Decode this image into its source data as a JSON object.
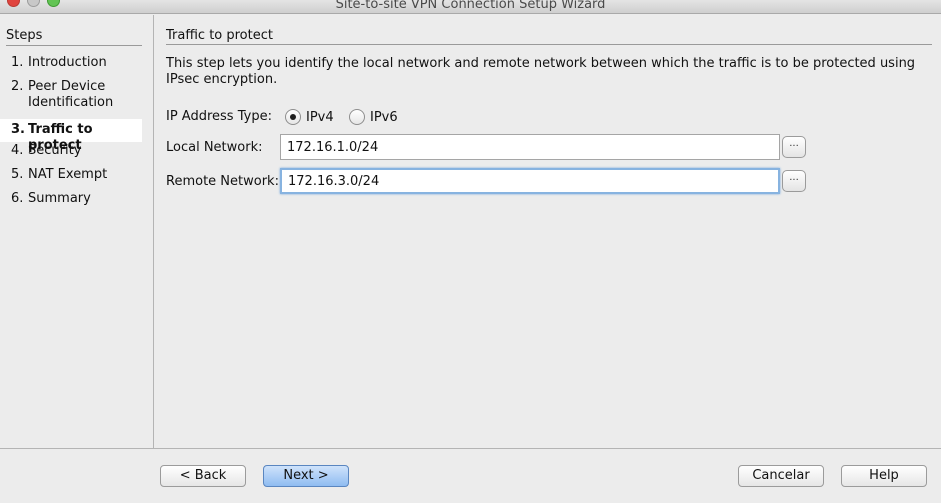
{
  "window": {
    "title": "Site-to-site VPN Connection Setup Wizard"
  },
  "sidebar": {
    "header": "Steps",
    "items": [
      {
        "num": "1.",
        "label": "Introduction"
      },
      {
        "num": "2.",
        "label": "Peer Device Identification"
      },
      {
        "num": "3.",
        "label": "Traffic to protect",
        "active": true
      },
      {
        "num": "4.",
        "label": "Security"
      },
      {
        "num": "5.",
        "label": "NAT Exempt"
      },
      {
        "num": "6.",
        "label": "Summary"
      }
    ]
  },
  "main": {
    "section_title": "Traffic to protect",
    "description": "This step lets you identify the local network and remote network between which the traffic is to be protected using IPsec encryption.",
    "ip_type": {
      "label": "IP Address Type:",
      "options": [
        {
          "label": "IPv4",
          "selected": true
        },
        {
          "label": "IPv6",
          "selected": false
        }
      ]
    },
    "local_network": {
      "label": "Local Network:",
      "value": "172.16.1.0/24",
      "browse_label": "..."
    },
    "remote_network": {
      "label": "Remote Network:",
      "value": "172.16.3.0/24",
      "browse_label": "..."
    }
  },
  "footer": {
    "back_label": "< Back",
    "next_label": "Next >",
    "cancel_label": "Cancelar",
    "help_label": "Help"
  }
}
